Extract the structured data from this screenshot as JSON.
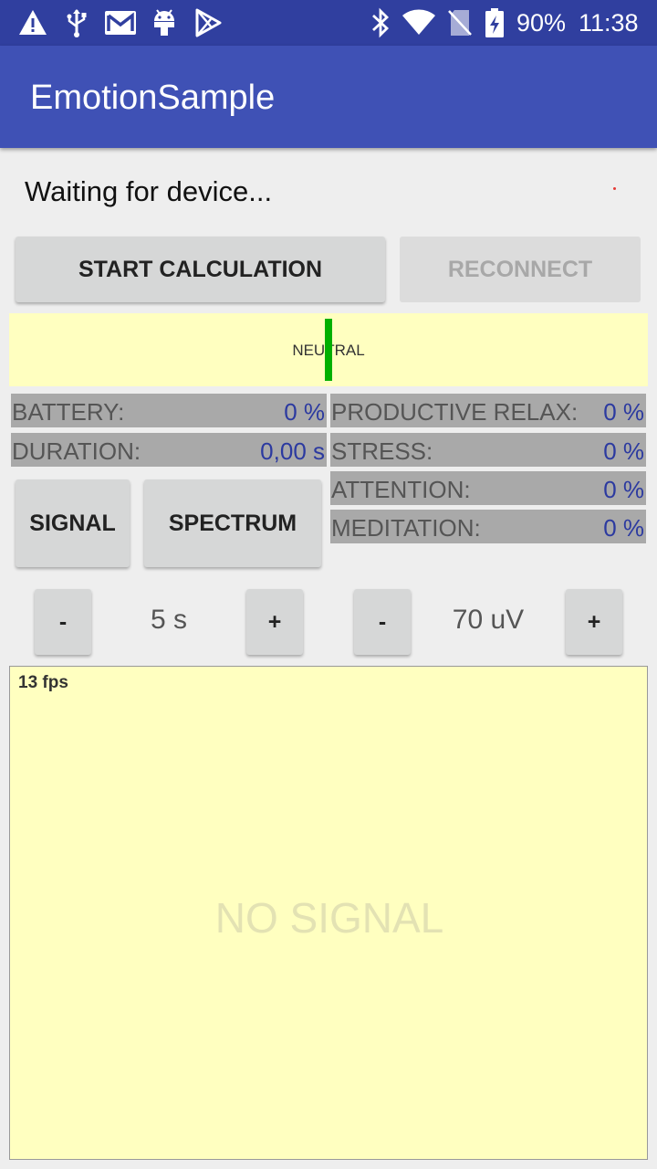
{
  "status_bar": {
    "icons": [
      "warning-icon",
      "usb-icon",
      "gmail-icon",
      "android-icon",
      "play-store-icon",
      "bluetooth-icon",
      "wifi-icon",
      "no-sim-icon",
      "battery-charging-icon"
    ],
    "battery": "90%",
    "time": "11:38"
  },
  "app_bar": {
    "title": "EmotionSample"
  },
  "status": {
    "text": "Waiting for device..."
  },
  "buttons": {
    "start_calc": "START CALCULATION",
    "reconnect": "RECONNECT",
    "signal": "SIGNAL",
    "spectrum": "SPECTRUM",
    "minus": "-",
    "plus": "+"
  },
  "emotion": {
    "label": "NEUTRAL"
  },
  "stats": {
    "battery": {
      "label": "BATTERY:",
      "value": "0 %"
    },
    "duration": {
      "label": "DURATION:",
      "value": "0,00 s"
    },
    "productive_relax": {
      "label": "PRODUCTIVE RELAX:",
      "value": "0 %"
    },
    "stress": {
      "label": "STRESS:",
      "value": "0 %"
    },
    "attention": {
      "label": "ATTENTION:",
      "value": "0 %"
    },
    "meditation": {
      "label": "MEDITATION:",
      "value": "0 %"
    }
  },
  "controls": {
    "time_scale": "5 s",
    "amplitude": "70 uV"
  },
  "graph": {
    "fps": "13 fps",
    "placeholder": "NO SIGNAL"
  },
  "colors": {
    "primary": "#3f51b5",
    "primary_dark": "#303f9f",
    "panel": "#ffffc0",
    "stat_bg": "#a9a9a9",
    "stat_value": "#2c3aa0",
    "emotion_marker": "#00b000"
  }
}
